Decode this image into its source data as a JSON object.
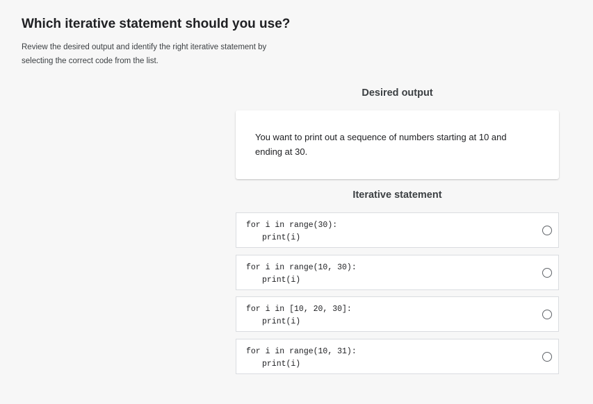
{
  "header": {
    "title": "Which iterative statement should you use?",
    "instructions": "Review the desired output and identify the right iterative statement by selecting the correct code from the list."
  },
  "desired_output": {
    "heading": "Desired output",
    "text": "You want to print out a sequence of numbers starting at 10 and ending at 30."
  },
  "iterative": {
    "heading": "Iterative statement",
    "options": [
      {
        "line1": "for i in range(30):",
        "line2": "print(i)",
        "selected": false
      },
      {
        "line1": "for i in range(10, 30):",
        "line2": "print(i)",
        "selected": false
      },
      {
        "line1": "for i in [10, 20, 30]:",
        "line2": "print(i)",
        "selected": false
      },
      {
        "line1": "for i in range(10, 31):",
        "line2": "print(i)",
        "selected": false
      }
    ]
  }
}
